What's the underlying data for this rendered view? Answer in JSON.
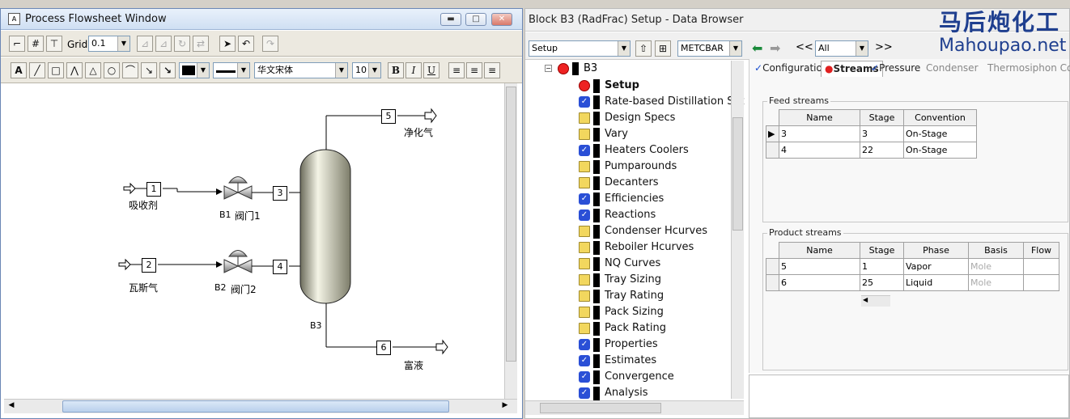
{
  "flowsheet": {
    "title": "Process Flowsheet Window",
    "grid_label": "Grid",
    "grid_value": "0.1",
    "font_name": "华文宋体",
    "font_size": "10",
    "blocks": {
      "s1": "1",
      "s2": "2",
      "s3": "3",
      "s4": "4",
      "s5": "5",
      "s6": "6"
    },
    "labels": {
      "absorbent": "吸收剂",
      "gas": "瓦斯气",
      "b1": "B1",
      "valve1": "阀门1",
      "b2": "B2",
      "valve2": "阀门2",
      "b3": "B3",
      "cleangas": "净化气",
      "richliquid": "富液"
    },
    "format_buttons": {
      "bold": "B",
      "italic": "I",
      "underline": "U",
      "text": "A"
    }
  },
  "browser": {
    "title": "Block B3 (RadFrac) Setup - Data Browser",
    "nav_combo": "Setup",
    "units_combo": "METCBAR",
    "filter_combo": "All",
    "back_label": "<<",
    "fwd_label": ">>",
    "tree_root": "B3",
    "tree": [
      {
        "label": "Setup",
        "icon": "red",
        "bold": true
      },
      {
        "label": "Rate-based Distillation Set",
        "icon": "check"
      },
      {
        "label": "Design Specs",
        "icon": "folder"
      },
      {
        "label": "Vary",
        "icon": "folder"
      },
      {
        "label": "Heaters Coolers",
        "icon": "check"
      },
      {
        "label": "Pumparounds",
        "icon": "folder"
      },
      {
        "label": "Decanters",
        "icon": "folder"
      },
      {
        "label": "Efficiencies",
        "icon": "check"
      },
      {
        "label": "Reactions",
        "icon": "check"
      },
      {
        "label": "Condenser Hcurves",
        "icon": "folder"
      },
      {
        "label": "Reboiler Hcurves",
        "icon": "folder"
      },
      {
        "label": "NQ Curves",
        "icon": "folder"
      },
      {
        "label": "Tray Sizing",
        "icon": "folder"
      },
      {
        "label": "Tray Rating",
        "icon": "folder"
      },
      {
        "label": "Pack Sizing",
        "icon": "folder"
      },
      {
        "label": "Pack Rating",
        "icon": "folder"
      },
      {
        "label": "Properties",
        "icon": "check"
      },
      {
        "label": "Estimates",
        "icon": "check"
      },
      {
        "label": "Convergence",
        "icon": "check"
      },
      {
        "label": "Analysis",
        "icon": "check"
      }
    ],
    "tabs": {
      "configuration": "Configuration",
      "streams": "Streams",
      "pressure": "Pressure",
      "condenser": "Condenser",
      "thermosiphon": "Thermosiphon Config"
    },
    "feed": {
      "title": "Feed streams",
      "headers": [
        "Name",
        "Stage",
        "Convention"
      ],
      "rows": [
        [
          "3",
          "3",
          "On-Stage"
        ],
        [
          "4",
          "22",
          "On-Stage"
        ]
      ]
    },
    "product": {
      "title": "Product streams",
      "headers": [
        "Name",
        "Stage",
        "Phase",
        "Basis",
        "Flow"
      ],
      "rows": [
        [
          "5",
          "1",
          "Vapor",
          "Mole",
          ""
        ],
        [
          "6",
          "25",
          "Liquid",
          "Mole",
          ""
        ]
      ]
    }
  },
  "watermark": {
    "cn": "马后炮化工",
    "en": "Mahoupao.net"
  }
}
